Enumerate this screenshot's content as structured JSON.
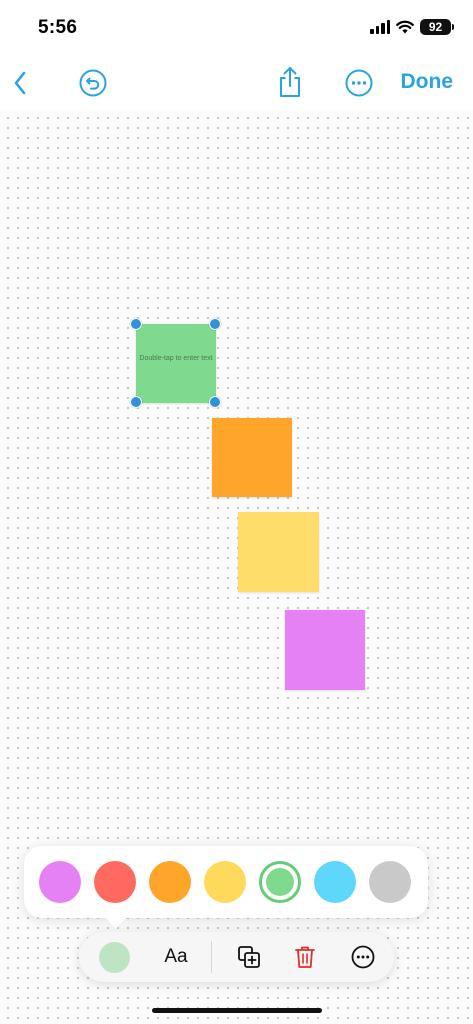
{
  "status": {
    "time": "5:56",
    "battery": "92"
  },
  "toolbar": {
    "done_label": "Done"
  },
  "canvas": {
    "selected_note_hint": "Double-tap to enter text"
  },
  "palette": {
    "colors": [
      "#e680f5",
      "#ff6960",
      "#ffa62a",
      "#ffd95c",
      "#7fd98e",
      "#5fd7fb",
      "#c9c9c9"
    ],
    "selected": "#7fd98e"
  },
  "edit_bar": {
    "text_style_label": "Aa"
  },
  "notes": {
    "green": "#7fd98e",
    "orange": "#ffa62a",
    "yellow": "#ffdd6a",
    "purple": "#e680f5"
  }
}
